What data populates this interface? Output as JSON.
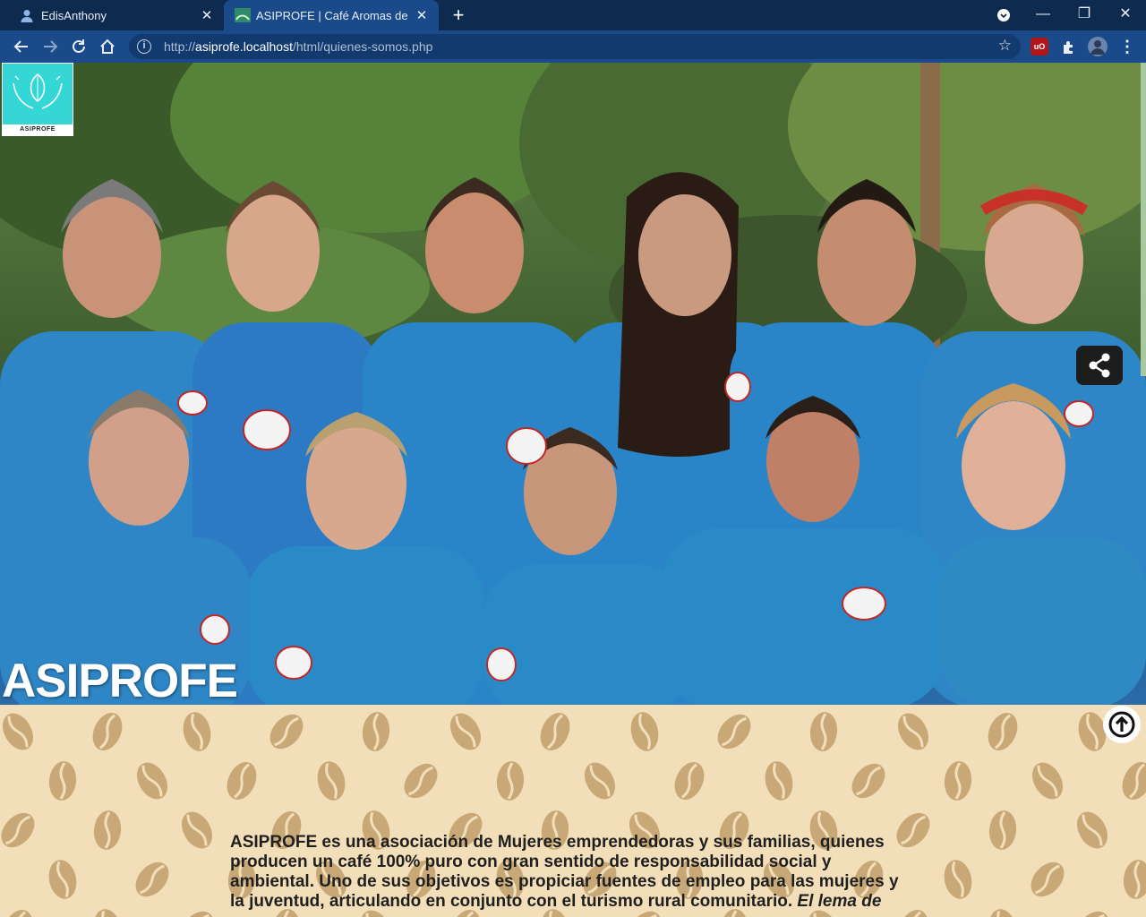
{
  "browser": {
    "tabs": [
      {
        "title": "EdisAnthony",
        "active": false
      },
      {
        "title": "ASIPROFE | Café Aromas de la Le",
        "active": true
      }
    ],
    "url_prefix": "http://",
    "url_host": "asiprofe.localhost",
    "url_path": "/html/quienes-somos.php"
  },
  "hero": {
    "logo_label": "ASIPROFE",
    "title": "ASIPROFE"
  },
  "about": {
    "text": "ASIPROFE es una asociación de Mujeres emprendedoras y sus familias, quienes producen un café 100% puro con gran sentido de responsabilidad social y ambiental. Uno de sus objetivos es propiciar fuentes de empleo para las mujeres y la juventud, articulando en conjunto con el turismo rural comunitario.",
    "motto_label": "El lema de"
  },
  "colors": {
    "chrome_dark": "#0f2a4f",
    "chrome_toolbar": "#1a4a8a",
    "polo_blue": "#2a86c9",
    "logo_cyan": "#34d6d6",
    "bean_bg": "#f2dfb9",
    "bean": "#c9a878"
  },
  "icons": [
    "user-avatar-icon",
    "asiprofe-favicon",
    "back-icon",
    "forward-icon",
    "reload-icon",
    "home-icon",
    "info-icon",
    "star-icon",
    "ublock-icon",
    "extensions-icon",
    "profile-icon",
    "menu-icon",
    "share-icon",
    "scroll-up-icon"
  ]
}
